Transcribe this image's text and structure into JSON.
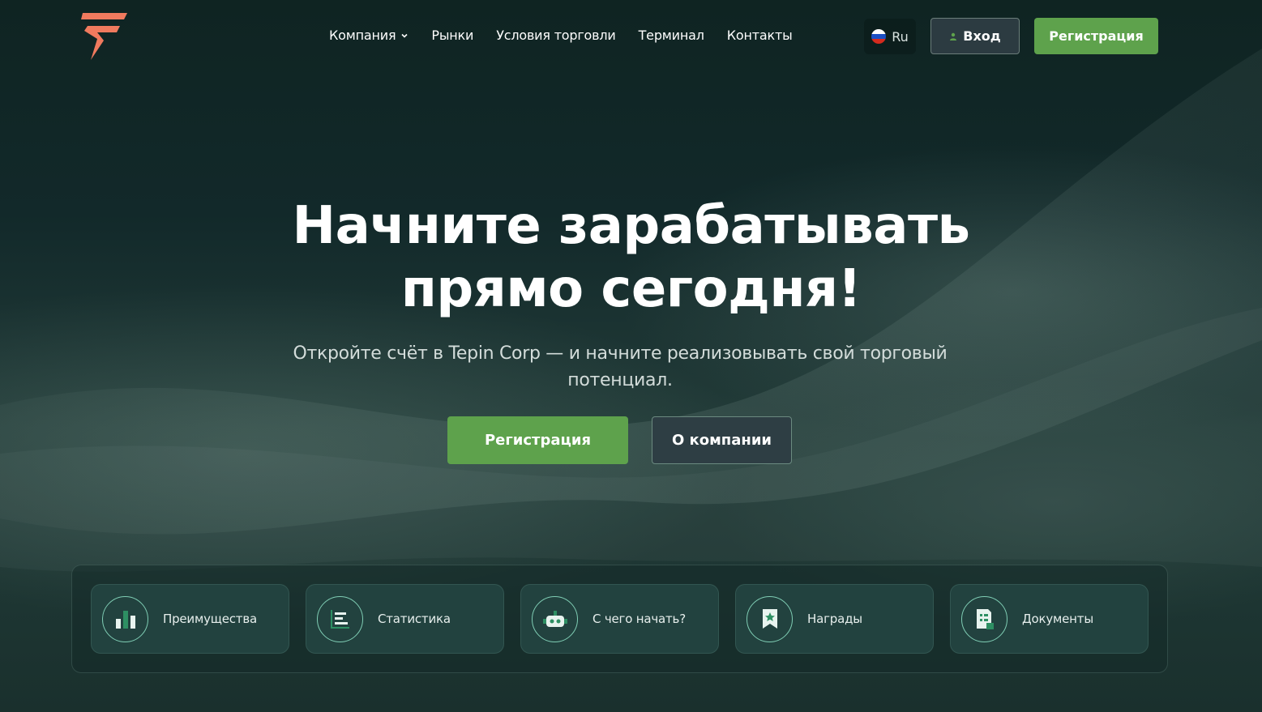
{
  "header": {
    "logo": "tepin-logo",
    "nav": [
      {
        "label": "Компания",
        "dropdown": true
      },
      {
        "label": "Рынки"
      },
      {
        "label": "Условия торговли"
      },
      {
        "label": "Терминал"
      },
      {
        "label": "Контакты"
      }
    ],
    "language": "Ru",
    "login_label": "Вход",
    "register_label": "Регистрация"
  },
  "hero": {
    "title_line1": "Начните зарабатывать",
    "title_line2": "прямо сегодня!",
    "subtitle": "Откройте счёт в Tepin Corp — и начните реализовывать свой торговый потенциал.",
    "register_label": "Регистрация",
    "about_label": "О компании"
  },
  "features": [
    {
      "label": "Преимущества",
      "icon": "bar-chart-icon"
    },
    {
      "label": "Статистика",
      "icon": "list-chart-icon"
    },
    {
      "label": "С чего начать?",
      "icon": "robot-icon"
    },
    {
      "label": "Награды",
      "icon": "award-icon"
    },
    {
      "label": "Документы",
      "icon": "document-icon"
    }
  ],
  "colors": {
    "accent_green": "#5ea24c",
    "icon_mint": "#7fcdb4",
    "logo_orange": "#f07a5e",
    "background": "#112523"
  }
}
